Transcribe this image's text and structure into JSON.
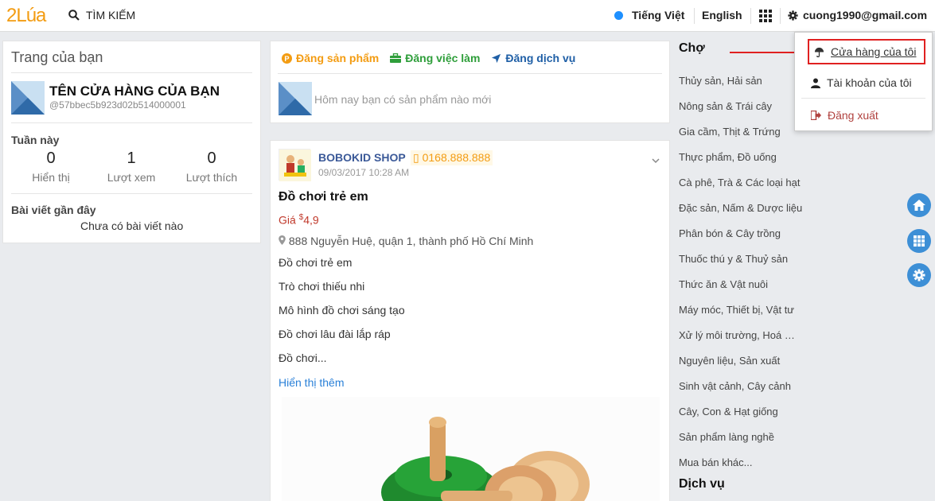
{
  "header": {
    "logo_a": "2",
    "logo_b": "Lúa",
    "search_label": "TÌM KIẾM",
    "lang_vi": "Tiếng Việt",
    "lang_en": "English",
    "user_email": "cuong1990@gmail.com",
    "active_lang_color": "#1e90ff"
  },
  "profile": {
    "title": "Trang của bạn",
    "shop_name": "TÊN CỬA HÀNG CỦA BẠN",
    "shop_id": "@57bbec5b923d02b514000001",
    "week_label": "Tuần này",
    "stats": [
      {
        "value": "0",
        "label": "Hiển thị"
      },
      {
        "value": "1",
        "label": "Lượt xem"
      },
      {
        "value": "0",
        "label": "Lượt thích"
      }
    ],
    "recent_label": "Bài viết gần đây",
    "recent_value": "Chưa có bài viết nào"
  },
  "composer": {
    "tab_product": "Đăng sản phẩm",
    "tab_job": "Đăng việc làm",
    "tab_service": "Đăng dịch vụ",
    "placeholder": "Hôm nay bạn có sản phẩm nào mới"
  },
  "post": {
    "shop": "BOBOKID SHOP",
    "phone": "0168.888.888",
    "date": "09/03/2017 10:28 AM",
    "title": "Đồ chơi trẻ em",
    "price_label": "Giá",
    "price_currency": "$",
    "price_value": "4,9",
    "address": "888 Nguyễn Huệ, quận 1, thành phố Hồ Chí Minh",
    "lines": [
      "Đồ chơi trẻ em",
      "Trò chơi thiếu nhi",
      "Mô hình đồ chơi sáng tạo",
      "Đồ chơi lâu đài lắp ráp",
      "Đồ chơi..."
    ],
    "more": "Hiển thị thêm"
  },
  "market": {
    "heading": "Chợ",
    "items": [
      "Thủy sản, Hải sản",
      "Nông sản & Trái cây",
      "Gia cầm, Thịt & Trứng",
      "Thực phẩm, Đồ uống",
      "Cà phê, Trà & Các loại hạt",
      "Đặc sản, Nấm & Dược liệu",
      "Phân bón & Cây trồng",
      "Thuốc thú y & Thuỷ sản",
      "Thức ăn & Vật nuôi",
      "Máy móc, Thiết bị, Vật tư",
      "Xử lý môi trường, Hoá …",
      "Nguyên liệu, Sản xuất",
      "Sinh vật cảnh, Cây cảnh",
      "Cây, Con & Hạt giống",
      "Sản phẩm làng nghề",
      "Mua bán khác..."
    ],
    "services_heading": "Dịch vụ"
  },
  "dropdown": {
    "my_store": "Cửa hàng của tôi",
    "my_account": "Tài khoản của tôi",
    "logout": "Đăng xuất",
    "highlight_color": "#e02020"
  },
  "colors": {
    "brand": "#f39c12",
    "link": "#2a80d8",
    "product_tab": "#f39c12",
    "job_tab": "#2e9e3a",
    "service_tab": "#1f5fa6",
    "fab": "#3d8fd6"
  },
  "icons": [
    "search-icon",
    "grid-icon",
    "gear-icon",
    "umbrella-icon",
    "user-icon",
    "logout-icon",
    "home-icon",
    "map-marker-icon",
    "mobile-icon",
    "chevron-down-icon"
  ]
}
